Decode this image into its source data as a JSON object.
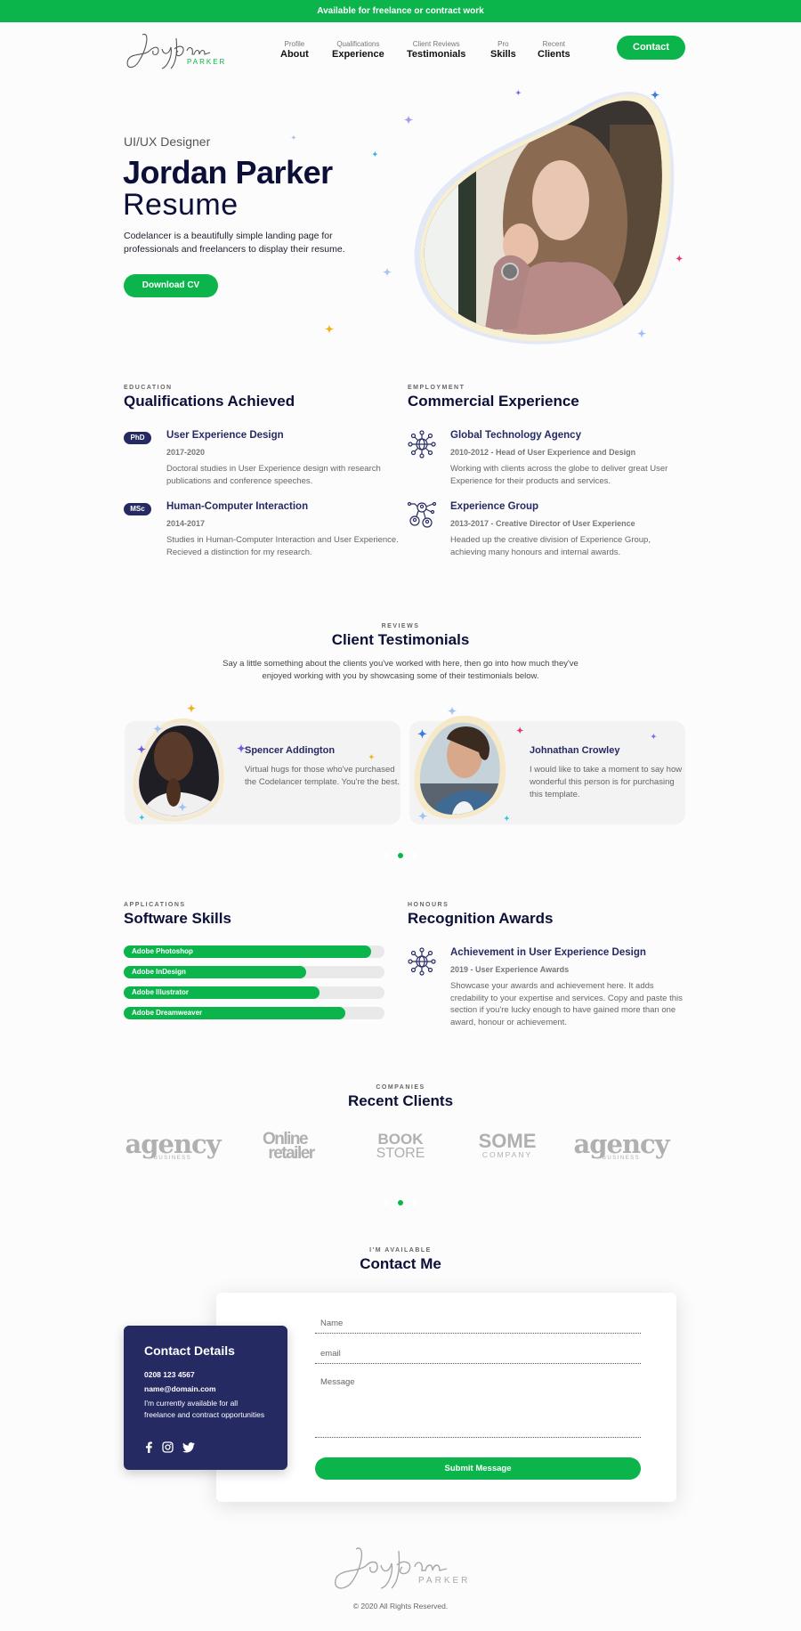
{
  "topbar": {
    "text": "Available for freelance or contract work"
  },
  "brand": {
    "script": "Jordan",
    "surname": "PARKER"
  },
  "nav": {
    "items": [
      {
        "sub": "Profile",
        "label": "About"
      },
      {
        "sub": "Qualifications",
        "label": "Experience"
      },
      {
        "sub": "Client Reviews",
        "label": "Testimonials"
      },
      {
        "sub": "Pro",
        "label": "Skills"
      },
      {
        "sub": "Recent",
        "label": "Clients"
      }
    ],
    "contact_label": "Contact"
  },
  "hero": {
    "role": "UI/UX Designer",
    "name": "Jordan Parker",
    "title_suffix": "Resume",
    "description": "Codelancer is a beautifully simple landing page for professionals and freelancers to display their resume.",
    "button_label": "Download CV"
  },
  "education": {
    "kicker": "EDUCATION",
    "title": "Qualifications Achieved",
    "items": [
      {
        "badge": "PhD",
        "title": "User Experience Design",
        "meta": "2017-2020",
        "desc": "Doctoral studies in User Experience design with research publications and conference speeches."
      },
      {
        "badge": "MSc",
        "title": "Human-Computer Interaction",
        "meta": "2014-2017",
        "desc": "Studies in Human-Computer Interaction and User Experience. Recieved a distinction for my research."
      }
    ]
  },
  "employment": {
    "kicker": "EMPLOYMENT",
    "title": "Commercial Experience",
    "items": [
      {
        "icon": "globe-network-icon",
        "title": "Global Technology Agency",
        "meta": "2010-2012 - Head of User Experience and Design",
        "desc": "Working with clients across the globe to deliver great User Experience for their products and services."
      },
      {
        "icon": "people-network-icon",
        "title": "Experience Group",
        "meta": "2013-2017 - Creative Director of User Experience",
        "desc": "Headed up the creative division of Experience Group, achieving many honours and internal awards."
      }
    ]
  },
  "testimonials": {
    "kicker": "REVIEWS",
    "title": "Client Testimonials",
    "intro": "Say a little something about the clients you've worked with here, then go into how much they've enjoyed working with you by showcasing some of their testimonials below.",
    "items": [
      {
        "name": "Spencer Addington",
        "text": "Virtual hugs for those who've purchased the Codelancer template. You're the best."
      },
      {
        "name": "Johnathan Crowley",
        "text": "I would like to take a moment to say how wonderful this person is for purchasing this template."
      }
    ],
    "active_slide": 2,
    "slide_count": 3
  },
  "skills": {
    "kicker": "APPLICATIONS",
    "title": "Software Skills",
    "items": [
      {
        "label": "Adobe Photoshop",
        "percent": 95
      },
      {
        "label": "Adobe InDesign",
        "percent": 70
      },
      {
        "label": "Adobe Illustrator",
        "percent": 75
      },
      {
        "label": "Adobe Dreamweaver",
        "percent": 85
      }
    ]
  },
  "awards": {
    "kicker": "HONOURS",
    "title": "Recognition Awards",
    "items": [
      {
        "icon": "globe-network-icon",
        "title": "Achievement in User Experience Design",
        "meta": "2019 - User Experience Awards",
        "desc": "Showcase your awards and achievement here. It adds credability to your expertise and services. Copy and paste this section if you're lucky enough to have gained more than one award, honour or achievement."
      }
    ]
  },
  "clients": {
    "kicker": "COMPANIES",
    "title": "Recent Clients",
    "logos": [
      {
        "main": "agency",
        "sub": "BUSINESS"
      },
      {
        "main": "Online",
        "sub": "retailer"
      },
      {
        "main": "BOOK",
        "sub": "STORE"
      },
      {
        "main": "SOME",
        "sub": "COMPANY"
      },
      {
        "main": "agency",
        "sub": "BUSINESS"
      }
    ],
    "active_slide": 2,
    "slide_count": 3
  },
  "contact": {
    "kicker": "I'M AVAILABLE",
    "title": "Contact Me",
    "details_title": "Contact Details",
    "phone": "0208 123 4567",
    "email": "name@domain.com",
    "availability": "I'm currently available for all freelance and contract opportunities",
    "social": [
      "facebook-icon",
      "instagram-icon",
      "twitter-icon"
    ],
    "form": {
      "name_placeholder": "Name",
      "email_placeholder": "email",
      "message_placeholder": "Message",
      "submit_label": "Submit Message"
    }
  },
  "footer": {
    "copyright": "© 2020 All Rights Reserved."
  },
  "colors": {
    "accent": "#0bb54b",
    "navy": "#262a63",
    "heading": "#0c1038"
  }
}
